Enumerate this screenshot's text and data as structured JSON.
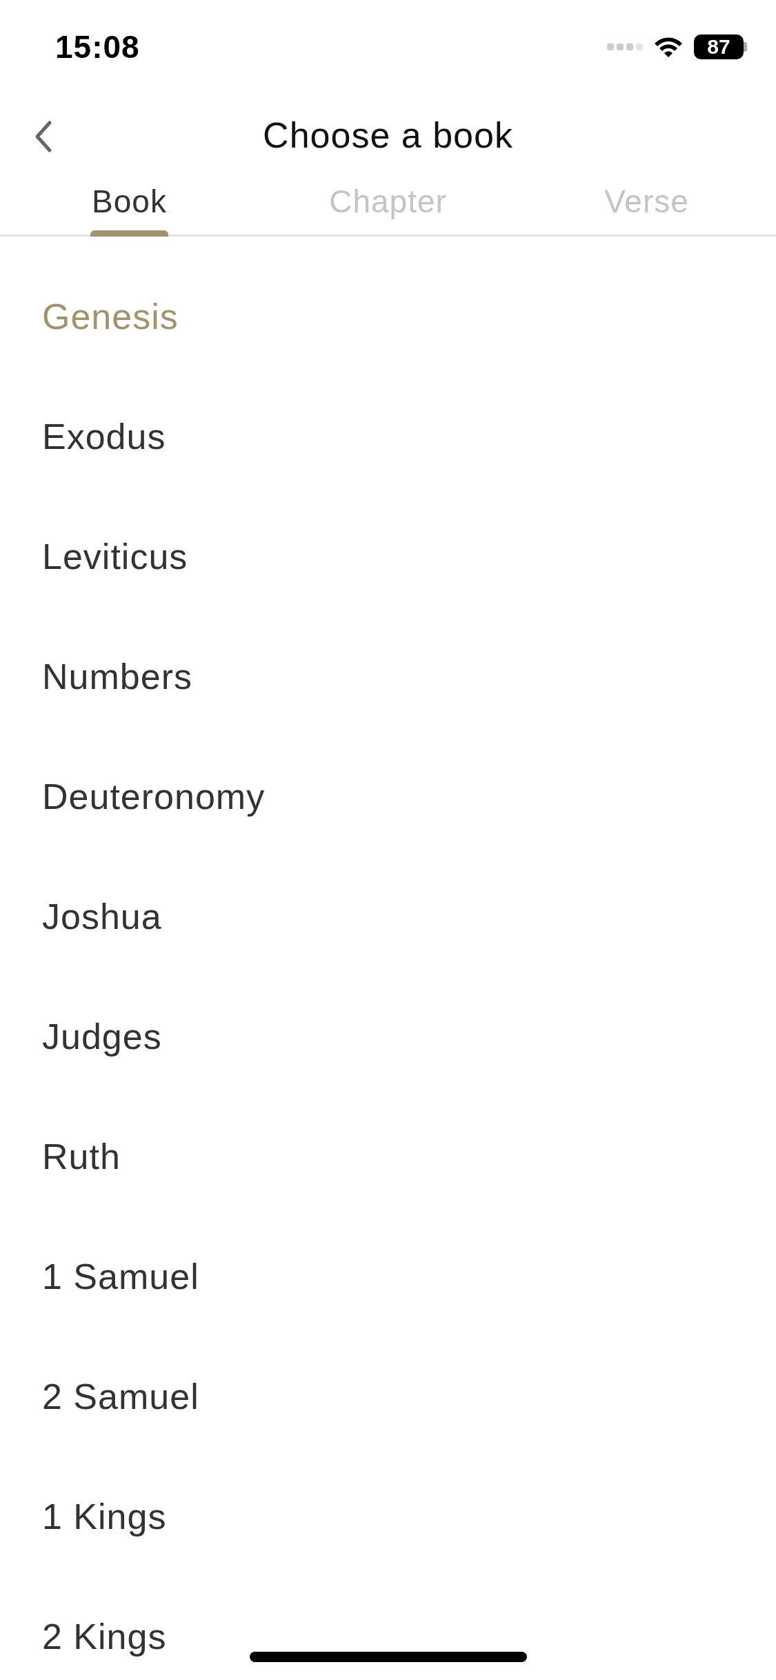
{
  "status_bar": {
    "time": "15:08",
    "battery": "87"
  },
  "header": {
    "title": "Choose a book"
  },
  "tabs": [
    {
      "label": "Book",
      "selected": true
    },
    {
      "label": "Chapter",
      "selected": false
    },
    {
      "label": "Verse",
      "selected": false
    }
  ],
  "books": [
    {
      "name": "Genesis",
      "selected": true
    },
    {
      "name": "Exodus",
      "selected": false
    },
    {
      "name": "Leviticus",
      "selected": false
    },
    {
      "name": "Numbers",
      "selected": false
    },
    {
      "name": "Deuteronomy",
      "selected": false
    },
    {
      "name": "Joshua",
      "selected": false
    },
    {
      "name": "Judges",
      "selected": false
    },
    {
      "name": "Ruth",
      "selected": false
    },
    {
      "name": "1 Samuel",
      "selected": false
    },
    {
      "name": "2 Samuel",
      "selected": false
    },
    {
      "name": "1 Kings",
      "selected": false
    },
    {
      "name": "2 Kings",
      "selected": false
    }
  ]
}
